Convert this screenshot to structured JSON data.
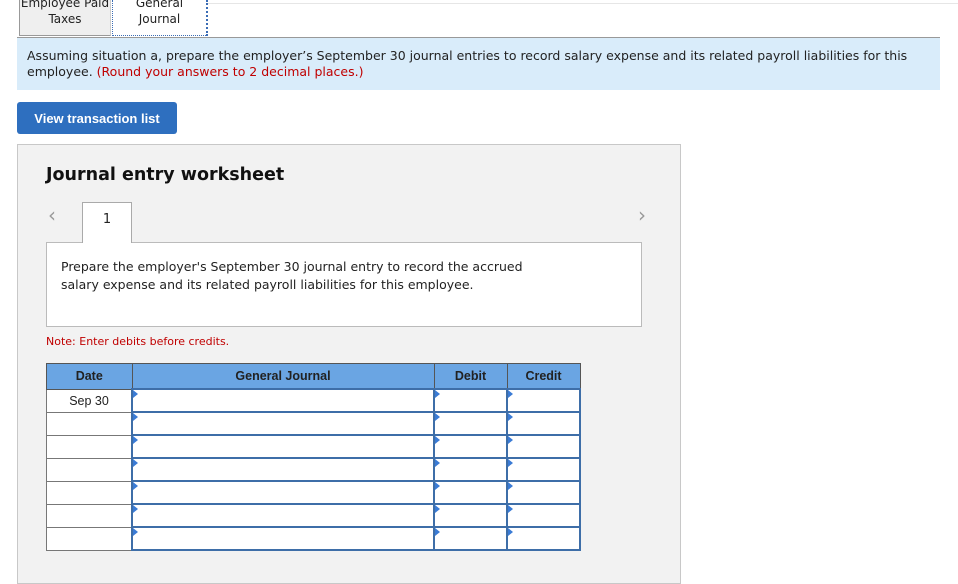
{
  "tabs": [
    {
      "label_line1": "Employee Paid",
      "label_line2": "Taxes",
      "active": false
    },
    {
      "label_line1": "General",
      "label_line2": "Journal",
      "active": true
    }
  ],
  "instructions": {
    "text": "Assuming situation a, prepare the employer’s September 30 journal entries to record salary expense and its related payroll liabilities for this employee.",
    "highlight": "(Round your answers to 2 decimal places.)"
  },
  "view_transactions_label": "View transaction list",
  "worksheet": {
    "title": "Journal entry worksheet",
    "prev_icon": "chevron-left-icon",
    "next_icon": "chevron-right-icon",
    "current_page": "1",
    "question": "Prepare the employer's September 30 journal entry to record the accrued salary expense and its related payroll liabilities for this employee.",
    "note": "Note: Enter debits before credits.",
    "table": {
      "headers": [
        "Date",
        "General Journal",
        "Debit",
        "Credit"
      ],
      "rows": [
        {
          "date": "Sep 30",
          "account": "",
          "debit": "",
          "credit": ""
        },
        {
          "date": "",
          "account": "",
          "debit": "",
          "credit": ""
        },
        {
          "date": "",
          "account": "",
          "debit": "",
          "credit": ""
        },
        {
          "date": "",
          "account": "",
          "debit": "",
          "credit": ""
        },
        {
          "date": "",
          "account": "",
          "debit": "",
          "credit": ""
        },
        {
          "date": "",
          "account": "",
          "debit": "",
          "credit": ""
        },
        {
          "date": "",
          "account": "",
          "debit": "",
          "credit": ""
        }
      ]
    }
  }
}
